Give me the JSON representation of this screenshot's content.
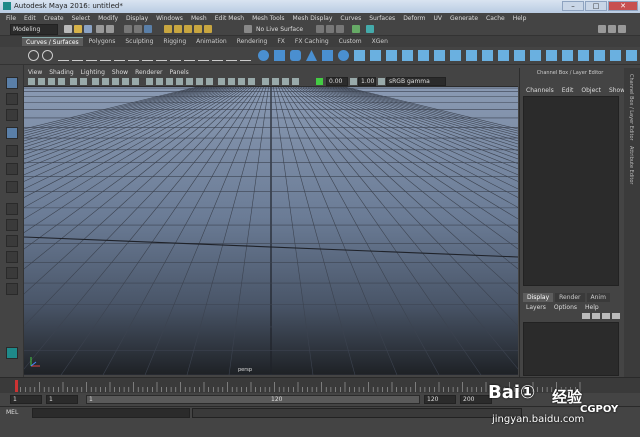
{
  "window": {
    "title": "Autodesk Maya 2016: untitled*",
    "minimize": "–",
    "maximize": "□",
    "close": "✕"
  },
  "menubar": [
    "File",
    "Edit",
    "Create",
    "Select",
    "Modify",
    "Display",
    "Windows",
    "Mesh",
    "Edit Mesh",
    "Mesh Tools",
    "Mesh Display",
    "Curves",
    "Surfaces",
    "Deform",
    "UV",
    "Generate",
    "Cache",
    "Help"
  ],
  "statusline": {
    "menuset": "Modeling",
    "live_surface": "No Live Surface"
  },
  "shelf_tabs": [
    {
      "label": "Curves / Surfaces",
      "active": true
    },
    {
      "label": "Polygons",
      "active": false
    },
    {
      "label": "Sculpting",
      "active": false
    },
    {
      "label": "Rigging",
      "active": false
    },
    {
      "label": "Animation",
      "active": false
    },
    {
      "label": "Rendering",
      "active": false
    },
    {
      "label": "FX",
      "active": false
    },
    {
      "label": "FX Caching",
      "active": false
    },
    {
      "label": "Custom",
      "active": false
    },
    {
      "label": "XGen",
      "active": false
    }
  ],
  "panel_menu": [
    "View",
    "Shading",
    "Lighting",
    "Show",
    "Renderer",
    "Panels"
  ],
  "panel_tools": {
    "field1": "0.00",
    "field2": "1.00",
    "colorspace": "sRGB gamma"
  },
  "viewport": {
    "camera_label": "persp",
    "axis_icon": "axis-gizmo-icon"
  },
  "channel_box": {
    "header": "Channel Box / Layer Editor",
    "menu": [
      "Channels",
      "Edit",
      "Object",
      "Show"
    ]
  },
  "layer_editor": {
    "tabs": [
      {
        "label": "Display",
        "active": true
      },
      {
        "label": "Render",
        "active": false
      },
      {
        "label": "Anim",
        "active": false
      }
    ],
    "menu": [
      "Layers",
      "Options",
      "Help"
    ]
  },
  "side_tabs": [
    "Channel Box / Layer Editor",
    "Attribute Editor"
  ],
  "range": {
    "start_field": "1",
    "start_field2": "1",
    "current_frame": "1",
    "end_mark": "120",
    "end_field": "120",
    "end_field2": "200"
  },
  "command_line": {
    "label": "MEL"
  },
  "watermark": {
    "brand": "Bai①",
    "cn": "经验",
    "url": "jingyan.baidu.com",
    "mark": "CGPOY"
  },
  "colors": {
    "accent": "#5a7fa8",
    "viewport_top": "#8a9ab3",
    "viewport_bottom": "#1e2125"
  }
}
